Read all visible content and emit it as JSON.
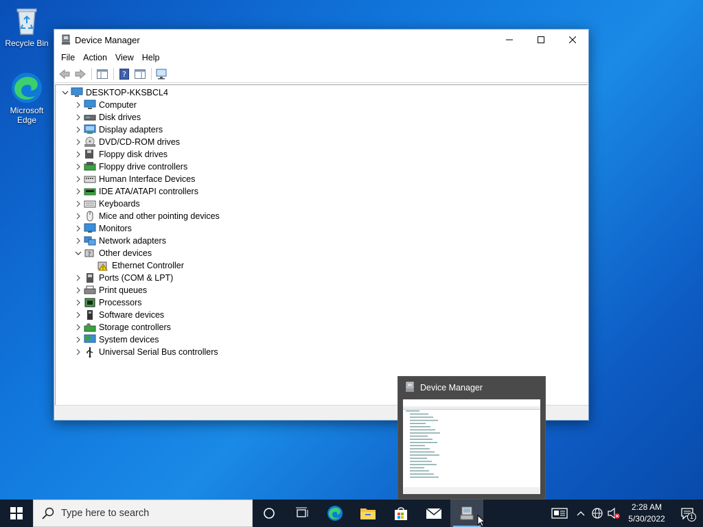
{
  "desktop": {
    "icons": [
      {
        "label": "Recycle Bin"
      },
      {
        "label": "Microsoft Edge"
      }
    ]
  },
  "window": {
    "title": "Device Manager",
    "menu": [
      "File",
      "Action",
      "View",
      "Help"
    ],
    "tree": {
      "root": "DESKTOP-KKSBCL4",
      "items": [
        {
          "label": "Computer",
          "icon": "computer-icon",
          "expanded": false
        },
        {
          "label": "Disk drives",
          "icon": "disk-drive-icon",
          "expanded": false
        },
        {
          "label": "Display adapters",
          "icon": "display-adapter-icon",
          "expanded": false
        },
        {
          "label": "DVD/CD-ROM drives",
          "icon": "dvd-drive-icon",
          "expanded": false
        },
        {
          "label": "Floppy disk drives",
          "icon": "floppy-disk-icon",
          "expanded": false
        },
        {
          "label": "Floppy drive controllers",
          "icon": "floppy-controller-icon",
          "expanded": false
        },
        {
          "label": "Human Interface Devices",
          "icon": "hid-icon",
          "expanded": false
        },
        {
          "label": "IDE ATA/ATAPI controllers",
          "icon": "ide-controller-icon",
          "expanded": false
        },
        {
          "label": "Keyboards",
          "icon": "keyboard-icon",
          "expanded": false
        },
        {
          "label": "Mice and other pointing devices",
          "icon": "mouse-icon",
          "expanded": false
        },
        {
          "label": "Monitors",
          "icon": "monitor-icon",
          "expanded": false
        },
        {
          "label": "Network adapters",
          "icon": "network-adapter-icon",
          "expanded": false
        },
        {
          "label": "Other devices",
          "icon": "other-devices-icon",
          "expanded": true,
          "children": [
            {
              "label": "Ethernet Controller",
              "icon": "warning-device-icon"
            }
          ]
        },
        {
          "label": "Ports (COM & LPT)",
          "icon": "port-icon",
          "expanded": false
        },
        {
          "label": "Print queues",
          "icon": "printer-icon",
          "expanded": false
        },
        {
          "label": "Processors",
          "icon": "processor-icon",
          "expanded": false
        },
        {
          "label": "Software devices",
          "icon": "software-device-icon",
          "expanded": false
        },
        {
          "label": "Storage controllers",
          "icon": "storage-controller-icon",
          "expanded": false
        },
        {
          "label": "System devices",
          "icon": "system-device-icon",
          "expanded": false
        },
        {
          "label": "Universal Serial Bus controllers",
          "icon": "usb-icon",
          "expanded": false
        }
      ]
    }
  },
  "thumbnail": {
    "title": "Device Manager"
  },
  "taskbar": {
    "search_placeholder": "Type here to search",
    "clock_time": "2:28 AM",
    "clock_date": "5/30/2022",
    "notification_count": "1"
  },
  "colors": {
    "accent": "#76b9ed",
    "taskbar": "#111d2c",
    "desktop": "#1177dd"
  }
}
